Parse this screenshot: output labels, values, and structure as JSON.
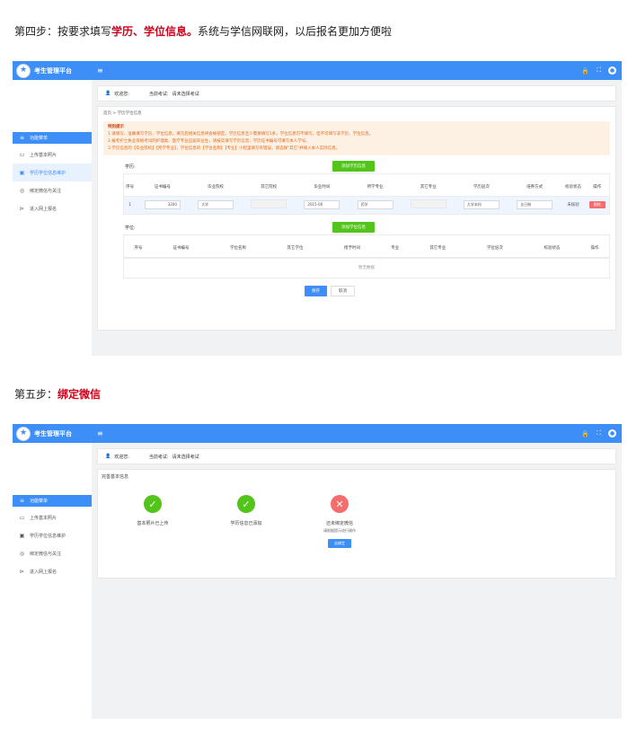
{
  "step4": {
    "prefix": "第四步：按要求填写",
    "highlight": "学历、学位信息。",
    "suffix": "系统与学信网联网，以后报名更加方便啦"
  },
  "step5": {
    "prefix": "第五步：",
    "highlight": "绑定微信"
  },
  "app": {
    "title": "考生管理平台",
    "logo_glyph": "★",
    "menu_icon": "≡",
    "lock_icon": "🔒",
    "fullscreen_icon": "⛶",
    "avatar_glyph": "●"
  },
  "sidebar": {
    "header": "功能菜单",
    "items": [
      {
        "label": "上传基本照片",
        "icon": "▭"
      },
      {
        "label": "学历学位信息维护",
        "icon": "▣"
      },
      {
        "label": "绑定微信与关注",
        "icon": "◎"
      },
      {
        "label": "进入网上报名",
        "icon": "⊳"
      }
    ]
  },
  "welcome": {
    "icon": "👤",
    "label": "欢迎您:",
    "exam_label": "当前考试:",
    "exam_value": "请未选择考试"
  },
  "screen1": {
    "breadcrumb": "首页 > 学历学位信息",
    "notice_title": "特别提示",
    "notice_lines": [
      "1.请填写、准确填写学历、学位信息，填写后相关信息将会被锁定。学历信息至少需要填写1条，学位信息可不填写，但不可填写非学历、学位信息。",
      "2.报考护士执业资格考试的护理类、医疗专业应届毕业生，请按实填写学历信息，学历证书编号可填写本人学号。",
      "3.学历信息的【毕业院校】【所学专业】，学位信息的【学位名称】【专业】小程里填写有错误，请选择\"其它\"并填入本人实际信息。"
    ],
    "degree_edu_label": "学历:",
    "add_edu_button": "添加学历信息",
    "edu_columns": [
      "序号",
      "证书编号",
      "毕业院校",
      "其它院校",
      "毕业时间",
      "所学专业",
      "其它专业",
      "学历层次",
      "培养方式",
      "校验状态",
      "操作"
    ],
    "edu_row": {
      "no": "1",
      "cert": "3200",
      "school": "大学",
      "other_school": "",
      "grad_time": "2015-06",
      "major": "药学",
      "other_major": "",
      "level": "大学本科",
      "mode": "全日制",
      "status": "未核验",
      "delete": "删除"
    },
    "degree_label": "学位:",
    "add_degree_button": "添加学位信息",
    "degree_columns": [
      "序号",
      "证书编号",
      "学位名称",
      "其它学位",
      "授予时间",
      "专业",
      "其它专业",
      "学位层次",
      "校验状态",
      "操作"
    ],
    "no_data": "暂无数据",
    "save_button": "保存",
    "cancel_button": "取消"
  },
  "screen2": {
    "section_title": "完善基本信息",
    "items": [
      {
        "icon": "✓",
        "label": "基本照片已上传",
        "sub": ""
      },
      {
        "icon": "✓",
        "label": "学历信息已添加",
        "sub": ""
      },
      {
        "icon": "✕",
        "label": "还未绑定微信",
        "sub": "请根据提示进行操作"
      }
    ],
    "bind_button": "去绑定"
  }
}
